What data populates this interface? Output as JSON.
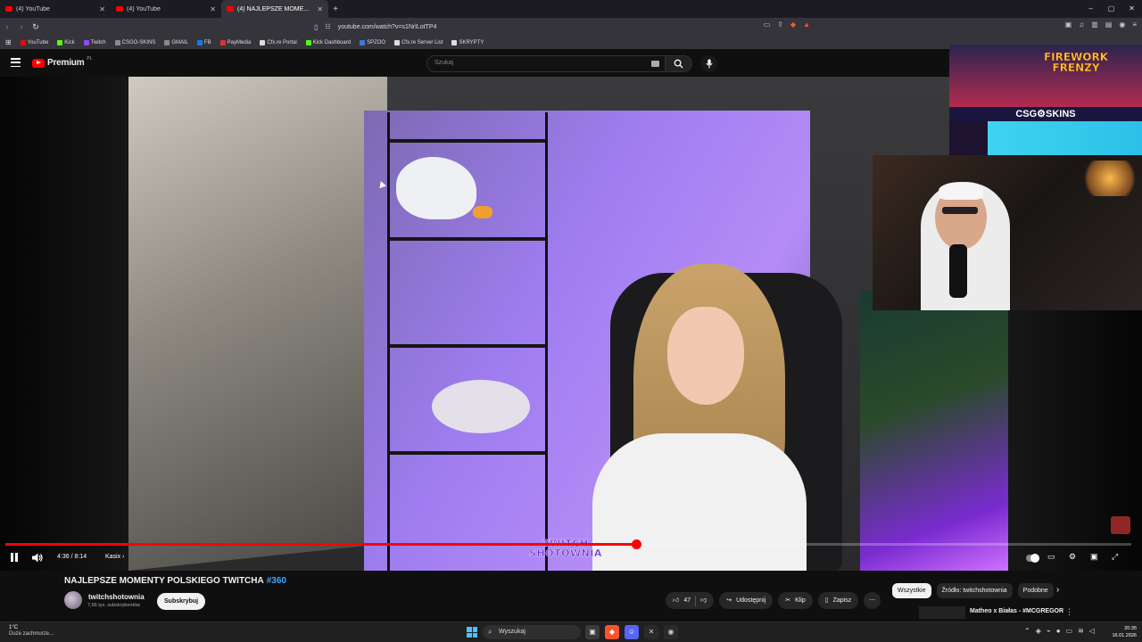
{
  "browser": {
    "tabs": [
      {
        "label": "(4) YouTube"
      },
      {
        "label": "(4) YouTube"
      },
      {
        "label": "(4) NAJLEPSZE MOMENTY PL"
      }
    ],
    "new_tab": "+",
    "url": "youtube.com/watch?v=s1NrlLotTP4",
    "window_controls": [
      "–",
      "▢",
      "✕"
    ],
    "bookmarks": [
      {
        "label": "YouTube",
        "color": "#ff0000"
      },
      {
        "label": "Kick",
        "color": "#53fc18"
      },
      {
        "label": "Twitch",
        "color": "#9146ff"
      },
      {
        "label": "CSGO-SKINS",
        "color": "#8a8a8a"
      },
      {
        "label": "GMAIL",
        "color": "#8a8a8a"
      },
      {
        "label": "FB",
        "color": "#1877f2"
      },
      {
        "label": "PayMedia",
        "color": "#e03030"
      },
      {
        "label": "Cfx.re Portal",
        "color": "#dddddd"
      },
      {
        "label": "Kick Dashboard",
        "color": "#53fc18"
      },
      {
        "label": "SPZOO",
        "color": "#3a7bd5"
      },
      {
        "label": "Cfx.re Server List",
        "color": "#dddddd"
      },
      {
        "label": "SKRYPTY",
        "color": "#dddddd"
      }
    ]
  },
  "youtube": {
    "logo_text": "Premium",
    "logo_region": "PL",
    "search_placeholder": "Szukaj"
  },
  "overlay": {
    "game_title": "FIREWORK FRENZY",
    "brand": "CSG⚙SKINS"
  },
  "video_banner": "TWITCH SHOTOWNIA",
  "player": {
    "time": "4:36 / 8:14",
    "chapter": "Kasix ›",
    "progress": 0.56
  },
  "video": {
    "title": "NAJLEPSZE MOMENTY POLSKIEGO TWITCHA",
    "hashtag": "#360",
    "channel": "twitchshotownia",
    "subscribers": "7,66 tys. subskrybentów",
    "subscribe_label": "Subskrybuj",
    "likes": "47",
    "share_label": "Udostępnij",
    "clip_label": "Klip",
    "save_label": "Zapisz"
  },
  "chips": [
    "Wszystkie",
    "Źródło: twitchshotownia",
    "Podobne"
  ],
  "recommendation": {
    "title": "Matheo x Białas - #MCGREGOR"
  },
  "taskbar": {
    "temp": "1°C",
    "weather": "Duże zachmurze...",
    "search": "Wyszukaj",
    "time": "20:35",
    "date": "16.01.2026"
  }
}
